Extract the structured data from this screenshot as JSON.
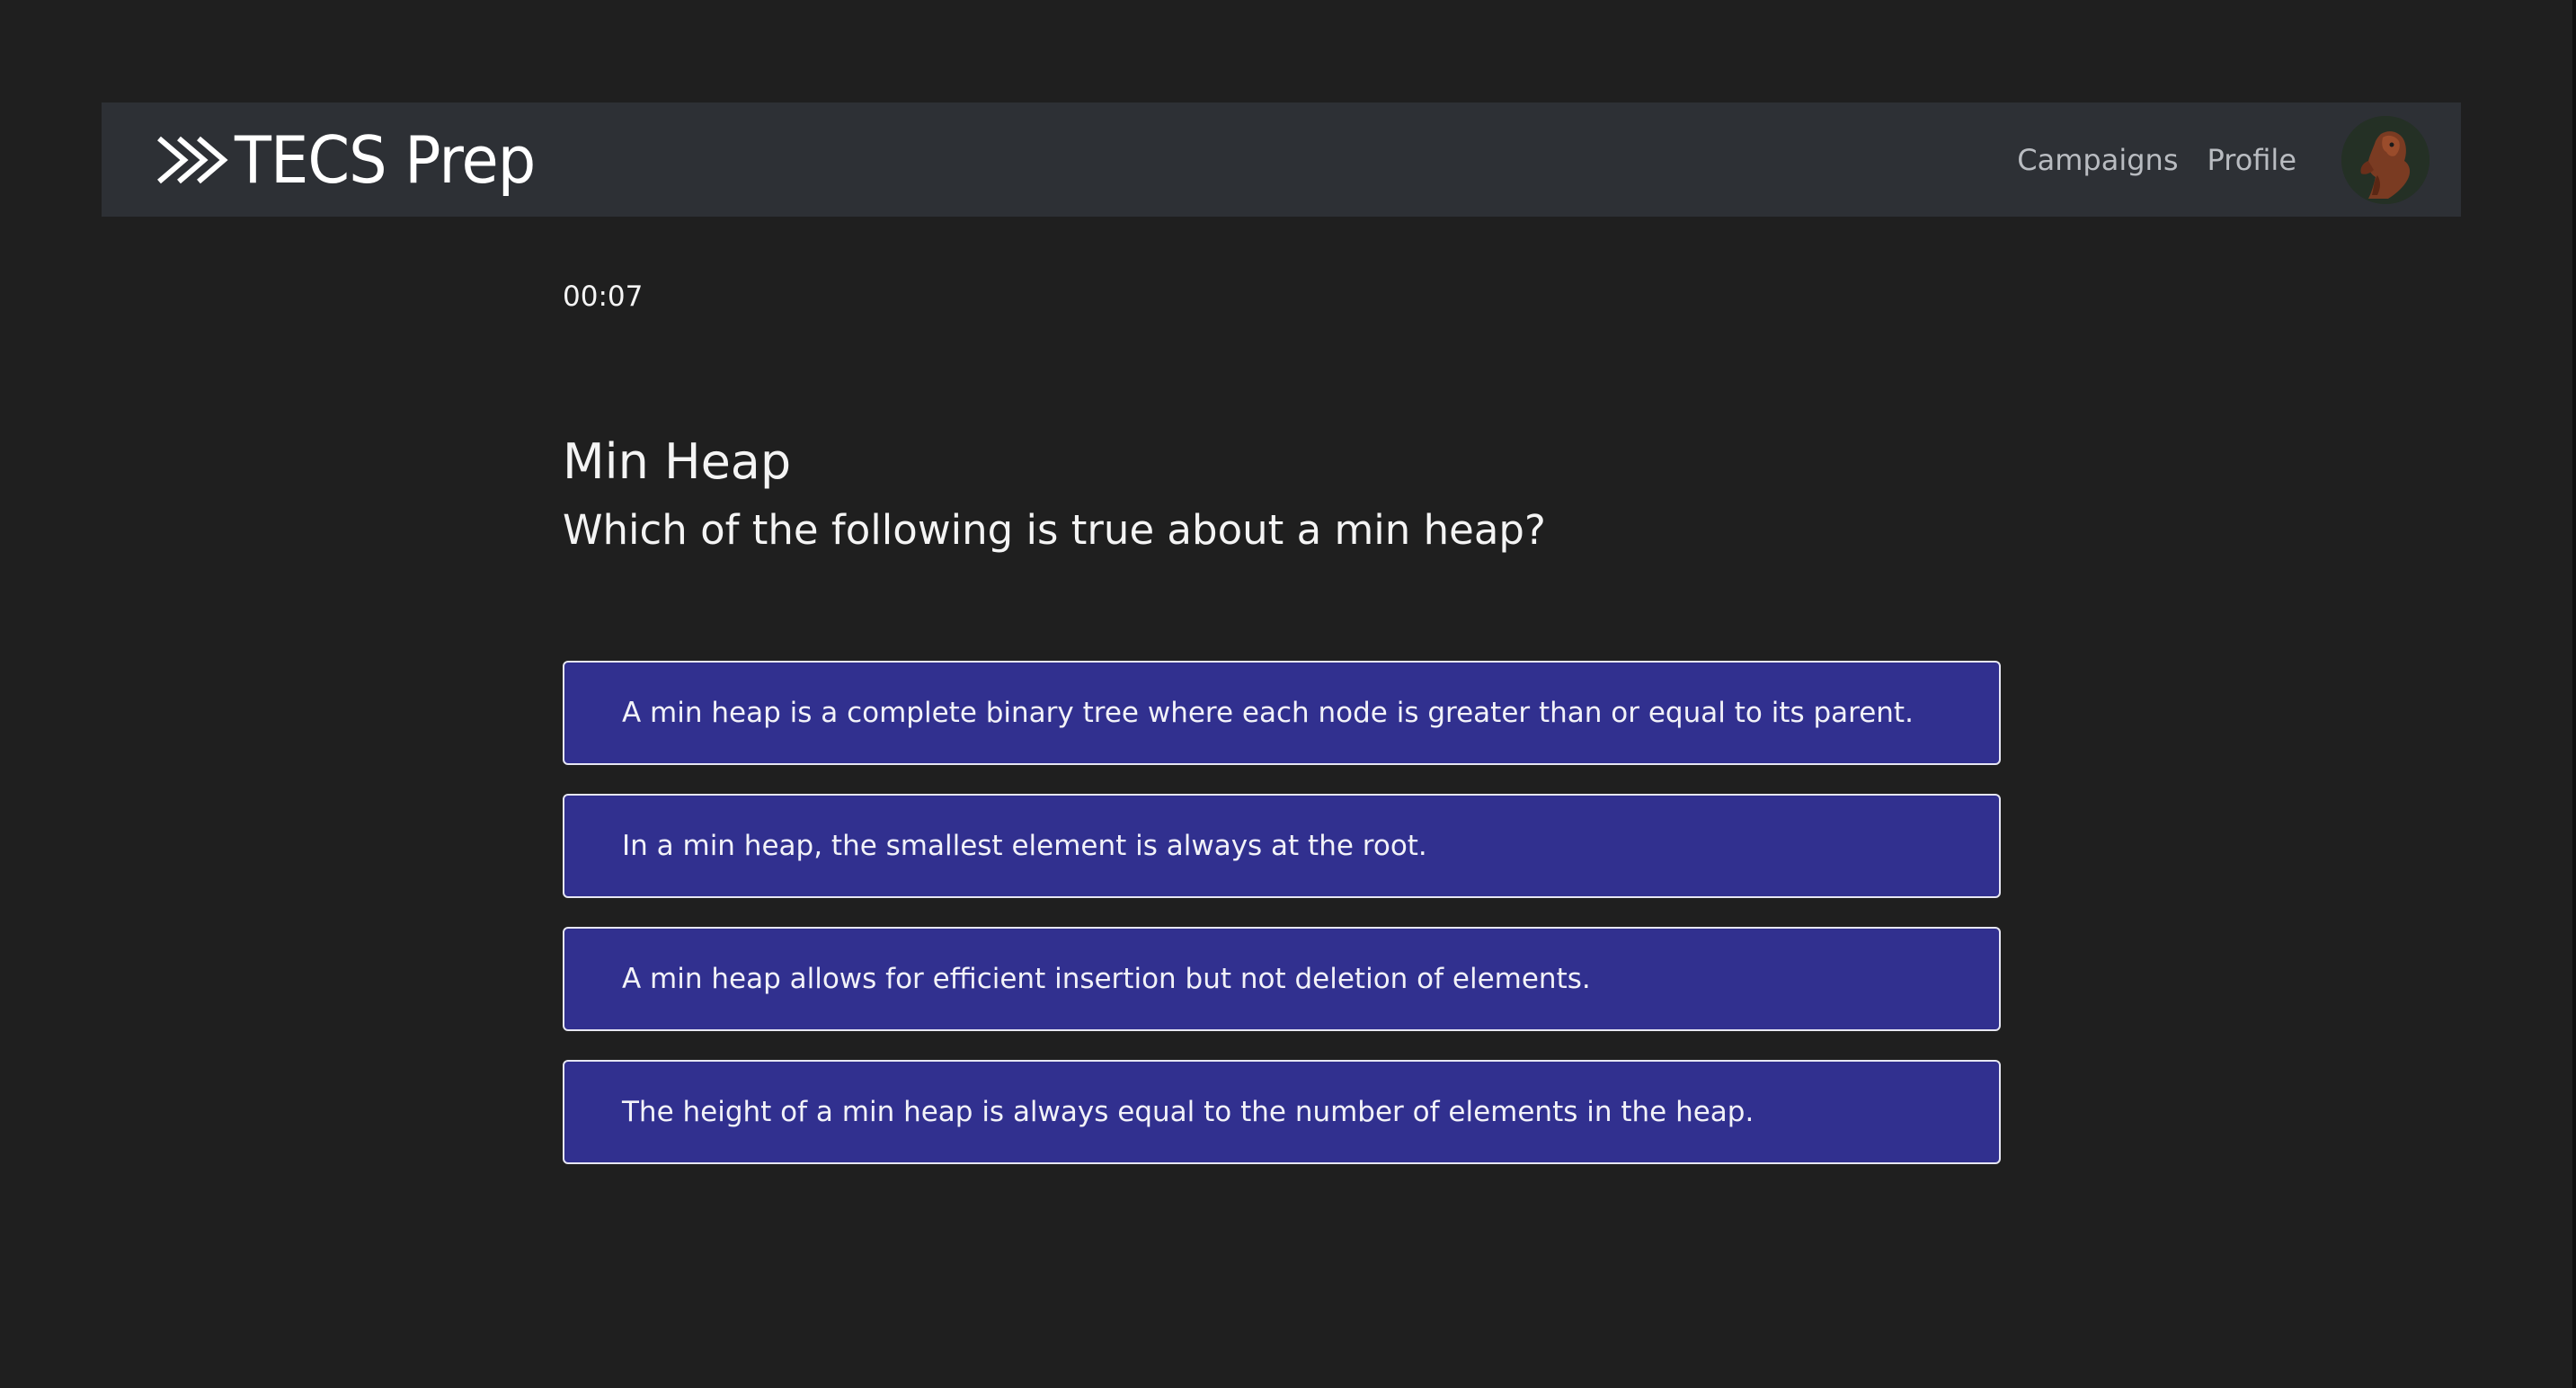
{
  "app": {
    "brand_name": "TECS Prep",
    "brand_icon": "double-chevron-right-icon"
  },
  "nav": {
    "items": [
      {
        "label": "Campaigns"
      },
      {
        "label": "Profile"
      }
    ],
    "avatar_icon": "dog-avatar-icon"
  },
  "quiz": {
    "timer": "00:07",
    "topic": "Min Heap",
    "question": "Which of the following is true about a min heap?",
    "answers": [
      {
        "text": "A min heap is a complete binary tree where each node is greater than or equal to its parent."
      },
      {
        "text": "In a min heap, the smallest element is always at the root."
      },
      {
        "text": "A min heap allows for efficient insertion but not deletion of elements."
      },
      {
        "text": "The height of a min heap is always equal to the number of elements in the heap."
      }
    ]
  },
  "colors": {
    "background": "#1f1f1f",
    "navbar": "#2d3035",
    "answer_fill": "#31308f",
    "answer_border": "#e6e6f2",
    "nav_text": "#b9bcc1"
  }
}
